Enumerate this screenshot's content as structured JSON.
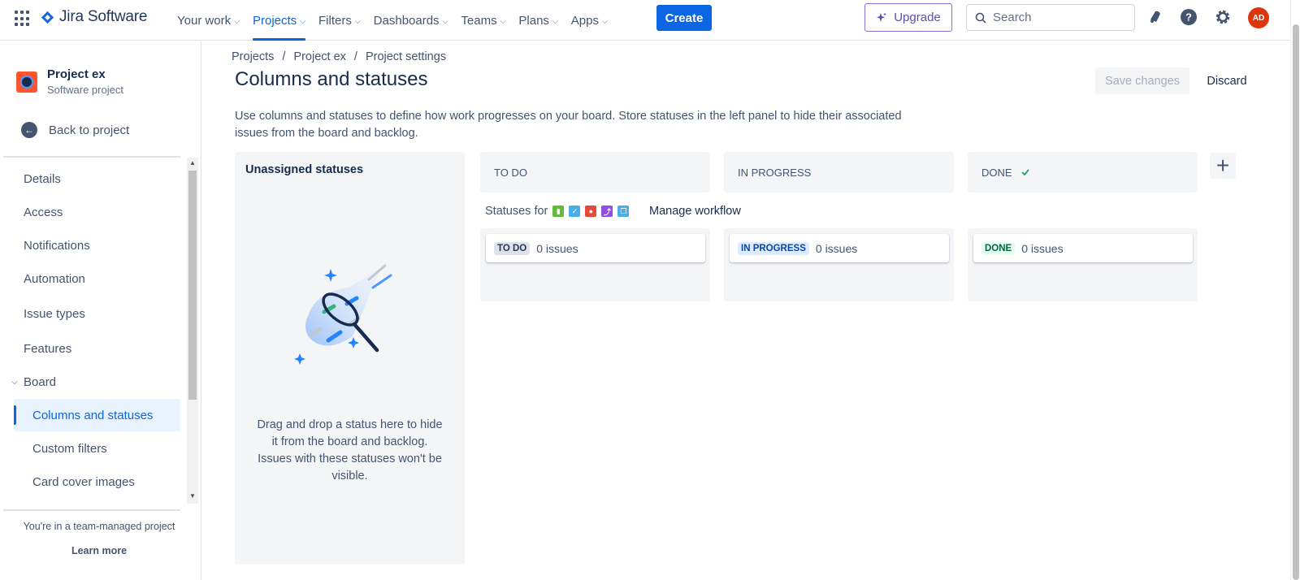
{
  "nav": {
    "logo_text": "Jira Software",
    "links": [
      {
        "label": "Your work"
      },
      {
        "label": "Projects"
      },
      {
        "label": "Filters"
      },
      {
        "label": "Dashboards"
      },
      {
        "label": "Teams"
      },
      {
        "label": "Plans"
      },
      {
        "label": "Apps"
      }
    ],
    "create_label": "Create",
    "upgrade_label": "Upgrade",
    "search_placeholder": "Search",
    "avatar_initials": "AD"
  },
  "sidebar": {
    "project_name": "Project ex",
    "project_type": "Software project",
    "back_label": "Back to project",
    "items": [
      {
        "label": "Details"
      },
      {
        "label": "Access"
      },
      {
        "label": "Notifications"
      },
      {
        "label": "Automation"
      },
      {
        "label": "Issue types"
      },
      {
        "label": "Features"
      },
      {
        "label": "Board"
      },
      {
        "label": "Columns and statuses"
      },
      {
        "label": "Custom filters"
      },
      {
        "label": "Card cover images"
      }
    ],
    "team_note": "You're in a team-managed project",
    "learn_more": "Learn more"
  },
  "main": {
    "breadcrumb": [
      "Projects",
      "Project ex",
      "Project settings"
    ],
    "breadcrumb_sep": "/",
    "title": "Columns and statuses",
    "save_label": "Save changes",
    "discard_label": "Discard",
    "description": "Use columns and statuses to define how work progresses on your board. Store statuses in the left panel to hide their associated issues from the board and backlog.",
    "unassigned": {
      "heading": "Unassigned statuses",
      "text": "Drag and drop a status here to hide it from the board and backlog. Issues with these statuses won't be visible."
    },
    "statuses_for_label": "Statuses for",
    "manage_workflow_label": "Manage workflow",
    "columns": [
      {
        "name": "TO DO",
        "status": "TO DO",
        "count": "0 issues"
      },
      {
        "name": "IN PROGRESS",
        "status": "IN PROGRESS",
        "count": "0 issues"
      },
      {
        "name": "DONE",
        "status": "DONE",
        "count": "0 issues"
      }
    ],
    "add_column_label": "+"
  },
  "colors": {
    "accent": "#0c66e4",
    "upgrade": "#5e4db2",
    "avatar": "#de350b"
  },
  "icons": [
    "app-switcher-icon",
    "jira-logo-icon",
    "sparkle-icon",
    "search-icon",
    "notification-icon",
    "help-icon",
    "settings-icon",
    "back-arrow-icon",
    "check-icon",
    "add-icon"
  ]
}
